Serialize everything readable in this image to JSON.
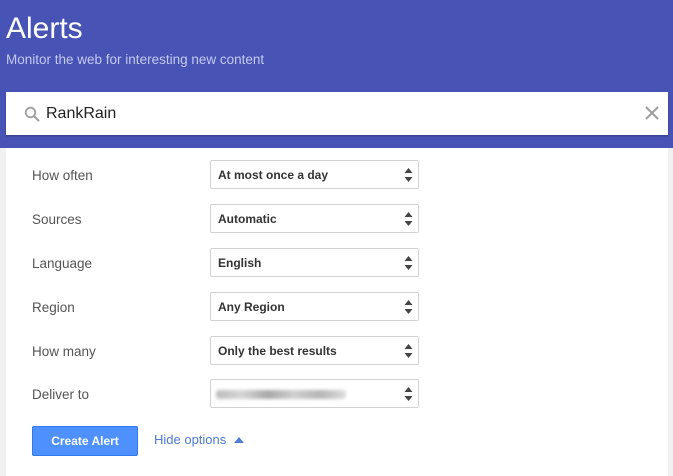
{
  "header": {
    "title": "Alerts",
    "subtitle": "Monitor the web for interesting new content",
    "background_color": "#4753b5"
  },
  "search": {
    "value": "RankRain",
    "search_icon": "search-icon",
    "clear_icon": "close-icon"
  },
  "options": [
    {
      "key": "how_often",
      "label": "How often",
      "value": "At most once a day"
    },
    {
      "key": "sources",
      "label": "Sources",
      "value": "Automatic"
    },
    {
      "key": "language",
      "label": "Language",
      "value": "English"
    },
    {
      "key": "region",
      "label": "Region",
      "value": "Any Region"
    },
    {
      "key": "how_many",
      "label": "How many",
      "value": "Only the best results"
    },
    {
      "key": "deliver_to",
      "label": "Deliver to",
      "value": ""
    }
  ],
  "actions": {
    "create_label": "Create Alert",
    "hide_options_label": "Hide options",
    "accent_color": "#4d90fe"
  }
}
